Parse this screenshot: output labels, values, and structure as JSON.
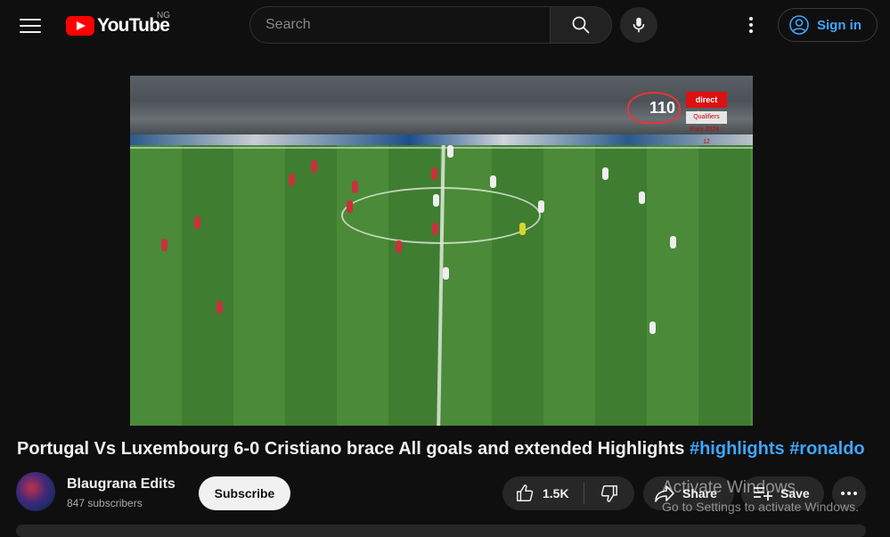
{
  "header": {
    "logo_text": "YouTube",
    "country_code": "NG",
    "search_placeholder": "Search",
    "signin_label": "Sign in",
    "icons": [
      "menu-icon",
      "youtube-logo-icon",
      "search-icon",
      "mic-icon",
      "more-vert-icon",
      "account-icon"
    ]
  },
  "player": {
    "overlay_badge_number": "110",
    "overlay_badge_brand": "direct L'ÉQUIPE",
    "overlay_badge_sub": "Qualifiers Euro 2024 - 12"
  },
  "video": {
    "title": "Portugal Vs Luxembourg 6-0 Cristiano brace All goals and extended Highlights",
    "hashtags": [
      "#highlights",
      "#ronaldo"
    ]
  },
  "channel": {
    "name": "Blaugrana Edits",
    "subscribers": "847 subscribers",
    "subscribe_label": "Subscribe"
  },
  "actions": {
    "likes": "1.5K",
    "share_label": "Share",
    "save_label": "Save"
  },
  "watermark": {
    "line1": "Activate Windows",
    "line2": "Go to Settings to activate Windows."
  },
  "colors": {
    "background": "#0f0f0f",
    "brand_red": "#ff0000",
    "link_blue": "#3ea6ff",
    "button_bg": "#272727"
  }
}
